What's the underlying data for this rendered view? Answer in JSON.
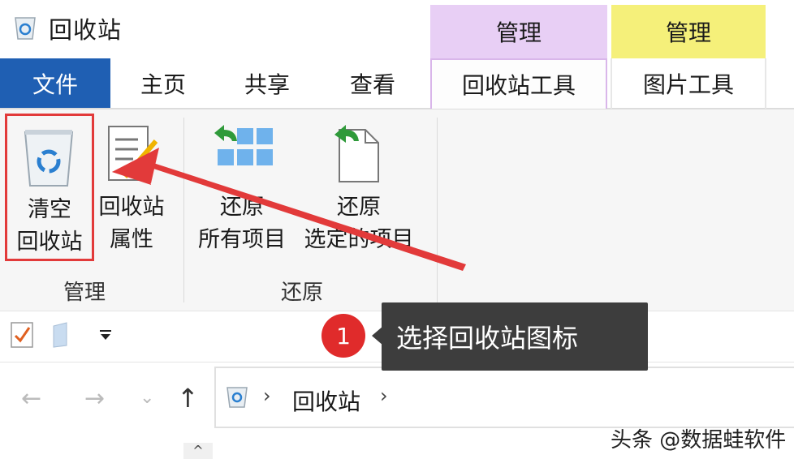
{
  "window": {
    "title": "回收站"
  },
  "context_headers": {
    "manage_recycle": "管理",
    "manage_picture": "管理"
  },
  "tabs": {
    "file": "文件",
    "home": "主页",
    "share": "共享",
    "view": "查看",
    "recycle_tools": "回收站工具",
    "picture_tools": "图片工具"
  },
  "ribbon": {
    "empty_recycle_bin": {
      "line1": "清空",
      "line2": "回收站"
    },
    "recycle_bin_properties": {
      "line1": "回收站",
      "line2": "属性"
    },
    "restore_all": {
      "line1": "还原",
      "line2": "所有项目"
    },
    "restore_selected": {
      "line1": "还原",
      "line2": "选定的项目"
    },
    "group_manage": "管理",
    "group_restore": "还原"
  },
  "annotation": {
    "step": "1",
    "tooltip": "选择回收站图标"
  },
  "address_bar": {
    "location": "回收站"
  },
  "watermark": "头条 @数据蛙软件",
  "colors": {
    "file_tab": "#1f5fb3",
    "manage_purple": "#e8cff5",
    "manage_yellow": "#f5f07a",
    "annotation_red": "#e02b2b"
  }
}
